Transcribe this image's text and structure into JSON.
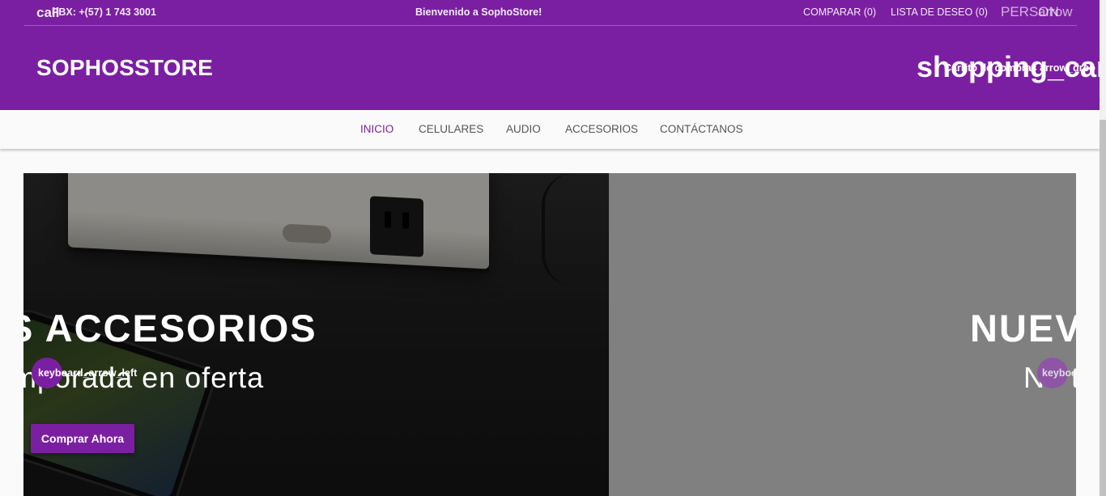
{
  "topbar": {
    "call_icon": "call",
    "phone_label": "PBX: +(57) 1 743 3001",
    "welcome": "Bienvenido a SophoStore!",
    "compare_label": "COMPARAR (0)",
    "wishlist_label": "LISTA DE DESEO (0)",
    "person_icon": "PERSON",
    "account_arrow_icon": "arrow"
  },
  "header": {
    "brand": "SOPHOSSTORE",
    "cart_icon": "shopping_cart",
    "cart_overlay_text": "Carrito de compras arrow_drop"
  },
  "nav": {
    "items": [
      {
        "label": "INICIO"
      },
      {
        "label": "CELULARES"
      },
      {
        "label": "AUDIO"
      },
      {
        "label": "ACCESORIOS"
      },
      {
        "label": "CONTÁCTANOS"
      }
    ]
  },
  "carousel": {
    "prev_icon": "keyboard_arrow_left",
    "next_icon": "keyboard_arrow_right",
    "slides": [
      {
        "title": "S ACCESORIOS",
        "subtitle": "mporada en oferta",
        "button": "Comprar Ahora"
      },
      {
        "title": "NUEV",
        "subtitle": "No t"
      }
    ]
  },
  "colors": {
    "brand_primary": "#7b1fa2",
    "nav_active": "#7b1fa2",
    "slide_2_bg": "#808080"
  }
}
